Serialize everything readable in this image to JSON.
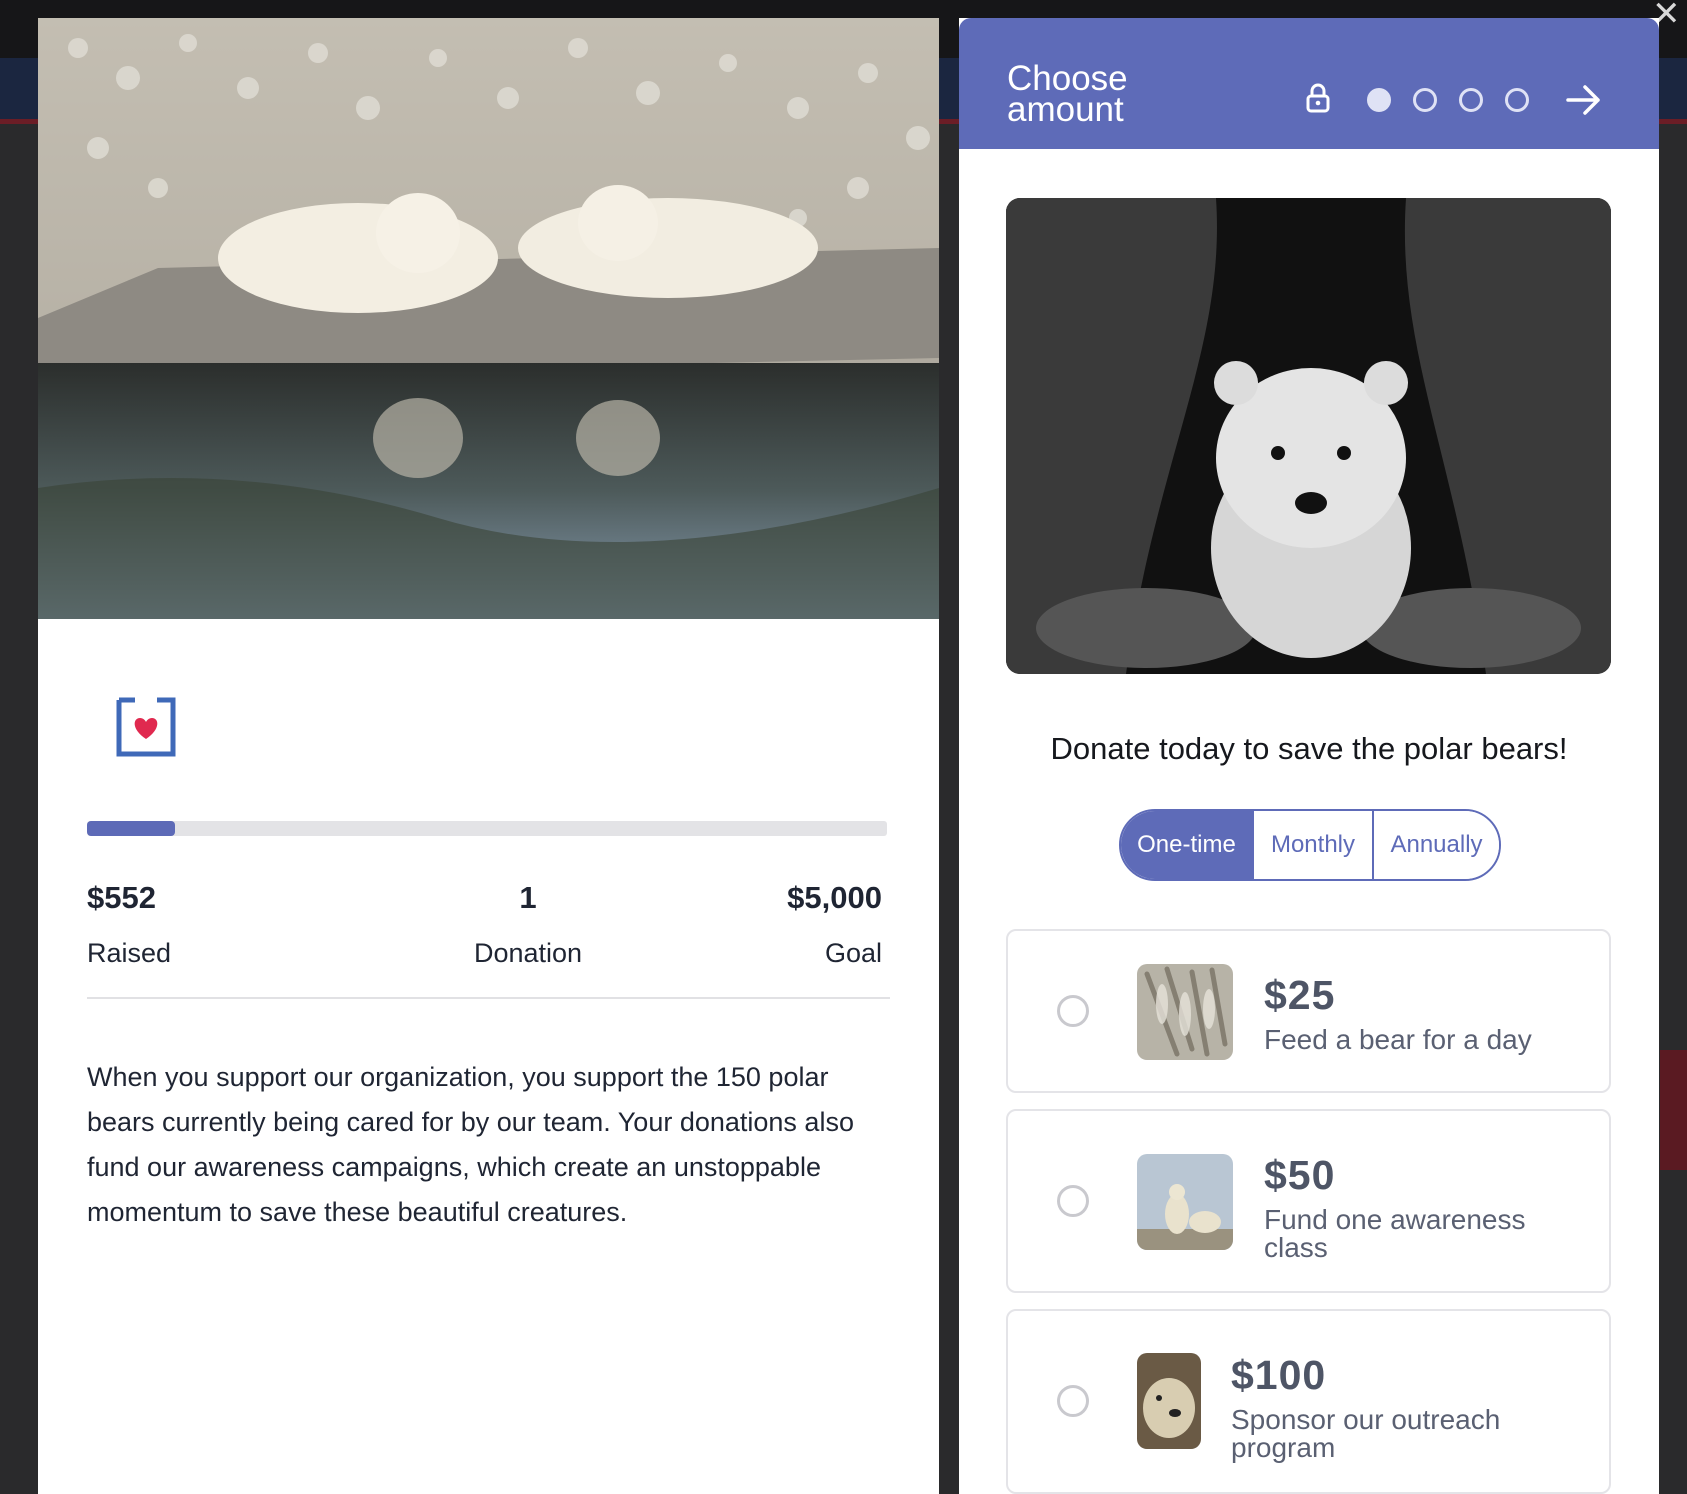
{
  "campaign": {
    "raised_value": "$552",
    "raised_label": "Raised",
    "donations_value": "1",
    "donations_label": "Donation",
    "goal_value": "$5,000",
    "goal_label": "Goal",
    "progress_fraction": 0.11,
    "description": "When you support our organization, you support the 150 polar bears currently being cared for by our team. Your donations also fund our awareness campaigns, which create an unstoppable momentum to save these beautiful creatures."
  },
  "donation_form": {
    "header_title": "Choose amount",
    "steps_total": 4,
    "current_step": 1,
    "tagline": "Donate today to save the polar bears!",
    "frequency_options": [
      "One-time",
      "Monthly",
      "Annually"
    ],
    "selected_frequency": "One-time",
    "amounts": [
      {
        "price": "$25",
        "description": "Feed a bear for a day"
      },
      {
        "price": "$50",
        "description": "Fund one awareness class"
      },
      {
        "price": "$100",
        "description": "Sponsor our outreach program"
      }
    ]
  },
  "colors": {
    "brand": "#5e6bb8",
    "heart": "#e0294f",
    "icon_blue": "#3f69b8"
  }
}
